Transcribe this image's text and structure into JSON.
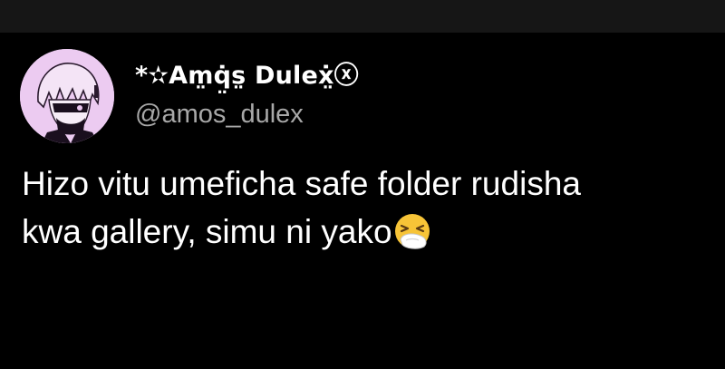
{
  "tweet": {
    "author": {
      "display_name": "*✫Am̤q̤̇s̤ Duleẋ̤ⓧ",
      "handle": "@amos_dulex",
      "avatar_icon": "anime-avatar"
    },
    "text_lines": [
      "Hizo vitu umeficha safe folder rudisha",
      "kwa gallery, simu ni yako"
    ],
    "emoji": "sneezing-face-icon"
  },
  "colors": {
    "background": "#000000",
    "top_band": "#161616",
    "text": "#ffffff",
    "handle": "#a8a8a8",
    "avatar_bg": "#e9c6ef"
  }
}
